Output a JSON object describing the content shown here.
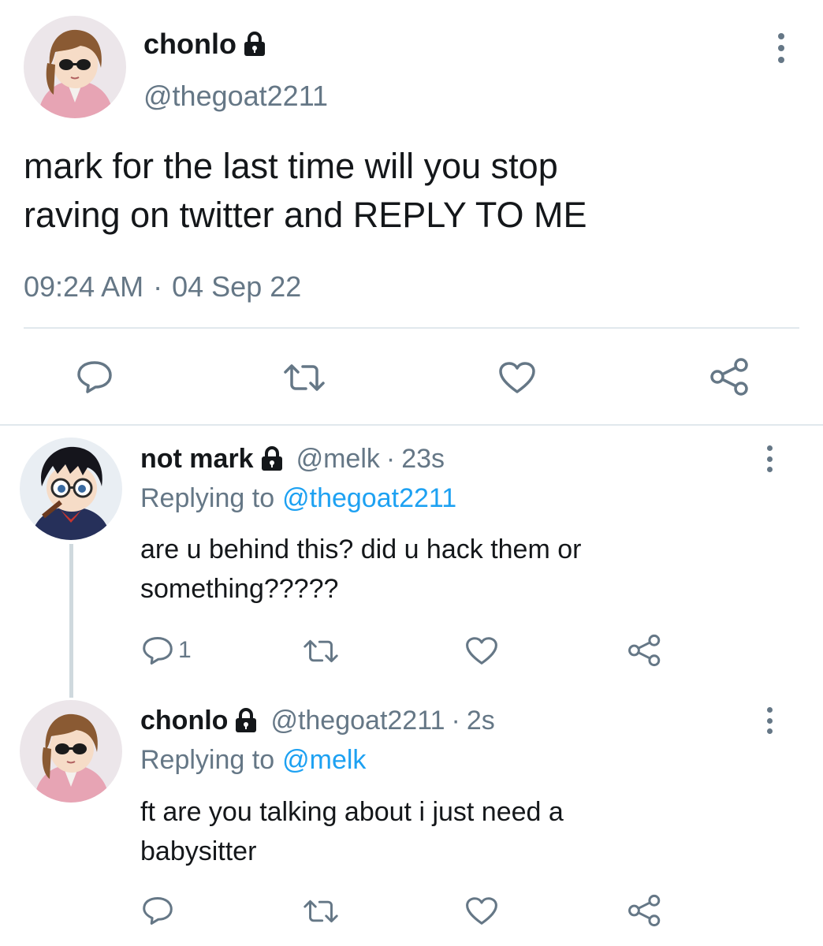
{
  "main_tweet": {
    "display_name": "chonlo",
    "handle": "@thegoat2211",
    "text_line1": "mark for the last time will you stop",
    "text_line2": "raving on twitter and REPLY TO ME",
    "time": "09:24 AM",
    "separator": "·",
    "date": "04 Sep 22",
    "icons": [
      "lock-icon",
      "more-icon",
      "reply-icon",
      "retweet-icon",
      "like-icon",
      "share-icon"
    ]
  },
  "replies": [
    {
      "display_name": "not mark",
      "handle": "@melk",
      "separator": "·",
      "age": "23s",
      "replying_prefix": "Replying to",
      "replying_to": "@thegoat2211",
      "text_line1": "are u behind this? did u hack them or",
      "text_line2": "something?????",
      "reply_count": "1"
    },
    {
      "display_name": "chonlo",
      "handle": "@thegoat2211",
      "separator": "·",
      "age": "2s",
      "replying_prefix": "Replying to",
      "replying_to": "@melk",
      "text_line1": "ft are you talking about i just need a",
      "text_line2": "babysitter",
      "reply_count": ""
    }
  ],
  "colors": {
    "text": "#14171a",
    "secondary": "#657786",
    "link": "#1da1f2",
    "divider": "#e1e8ed"
  }
}
